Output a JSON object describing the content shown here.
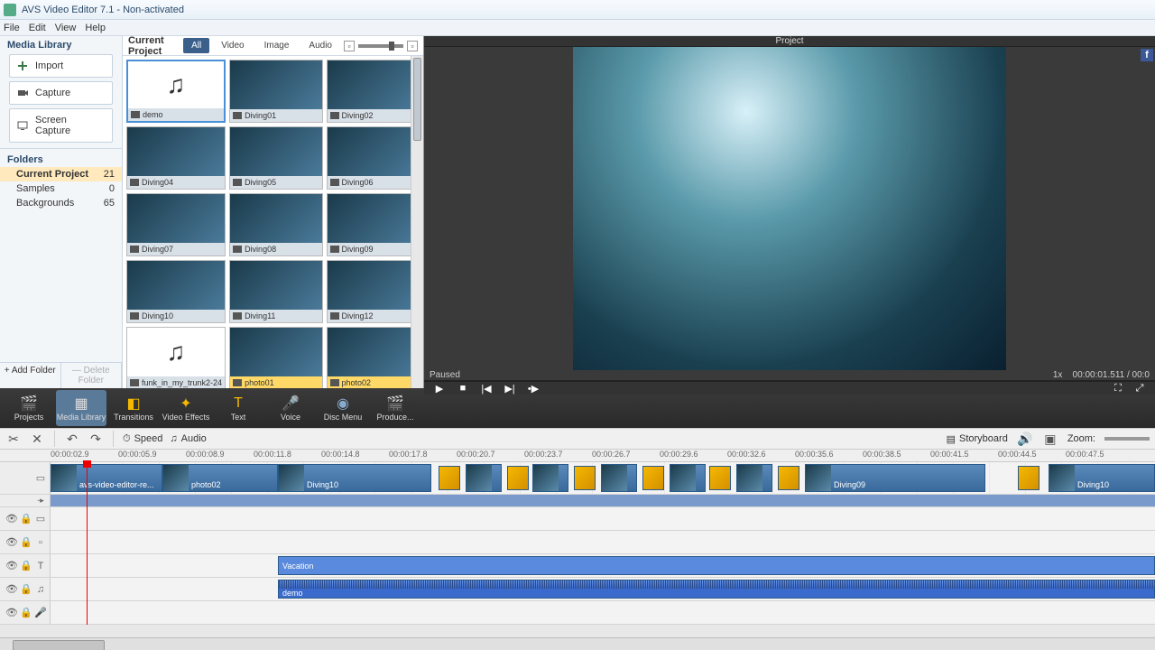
{
  "window": {
    "title": "AVS Video Editor 7.1 - Non-activated"
  },
  "menu": [
    "File",
    "Edit",
    "View",
    "Help"
  ],
  "sidebar": {
    "header": "Media Library",
    "buttons": {
      "import": "Import",
      "capture": "Capture",
      "screen": "Screen Capture"
    },
    "folders_label": "Folders",
    "folders": [
      {
        "name": "Current Project",
        "count": "21"
      },
      {
        "name": "Samples",
        "count": "0"
      },
      {
        "name": "Backgrounds",
        "count": "65"
      }
    ],
    "add_folder": "+ Add Folder",
    "del_folder": "— Delete Folder"
  },
  "browser": {
    "title": "Current Project",
    "tabs": [
      "All",
      "Video",
      "Image",
      "Audio"
    ],
    "thumbs": [
      {
        "label": "demo",
        "type": "audio"
      },
      {
        "label": "Diving01",
        "type": "video"
      },
      {
        "label": "Diving02",
        "type": "video"
      },
      {
        "label": "Diving04",
        "type": "video"
      },
      {
        "label": "Diving05",
        "type": "video"
      },
      {
        "label": "Diving06",
        "type": "video"
      },
      {
        "label": "Diving07",
        "type": "video"
      },
      {
        "label": "Diving08",
        "type": "video"
      },
      {
        "label": "Diving09",
        "type": "video"
      },
      {
        "label": "Diving10",
        "type": "video"
      },
      {
        "label": "Diving11",
        "type": "video"
      },
      {
        "label": "Diving12",
        "type": "video"
      },
      {
        "label": "funk_in_my_trunk2-24",
        "type": "audio"
      },
      {
        "label": "photo01",
        "type": "photo"
      },
      {
        "label": "photo02",
        "type": "photo"
      }
    ]
  },
  "preview": {
    "title": "Project",
    "status": "Paused",
    "time_left": "1x",
    "time_right": "00:00:01.511 / 00:0"
  },
  "mid": {
    "projects": "Projects",
    "library": "Media Library",
    "transitions": "Transitions",
    "effects": "Video Effects",
    "text": "Text",
    "voice": "Voice",
    "disc": "Disc Menu",
    "produce": "Produce..."
  },
  "tl_toolbar": {
    "speed": "Speed",
    "audio": "Audio",
    "storyboard": "Storyboard",
    "zoom": "Zoom:"
  },
  "ruler": [
    "00:00:02.9",
    "00:00:05.9",
    "00:00:08.9",
    "00:00:11.8",
    "00:00:14.8",
    "00:00:17.8",
    "00:00:20.7",
    "00:00:23.7",
    "00:00:26.7",
    "00:00:29.6",
    "00:00:32.6",
    "00:00:35.6",
    "00:00:38.5",
    "00:00:41.5",
    "00:00:44.5",
    "00:00:47.5"
  ],
  "clips": {
    "v1": "avs-video-editor-re...",
    "v2": "photo02",
    "v3": "Diving10",
    "v4": "Diving09",
    "v5": "Diving10",
    "text": "Vacation",
    "audio": "demo"
  }
}
